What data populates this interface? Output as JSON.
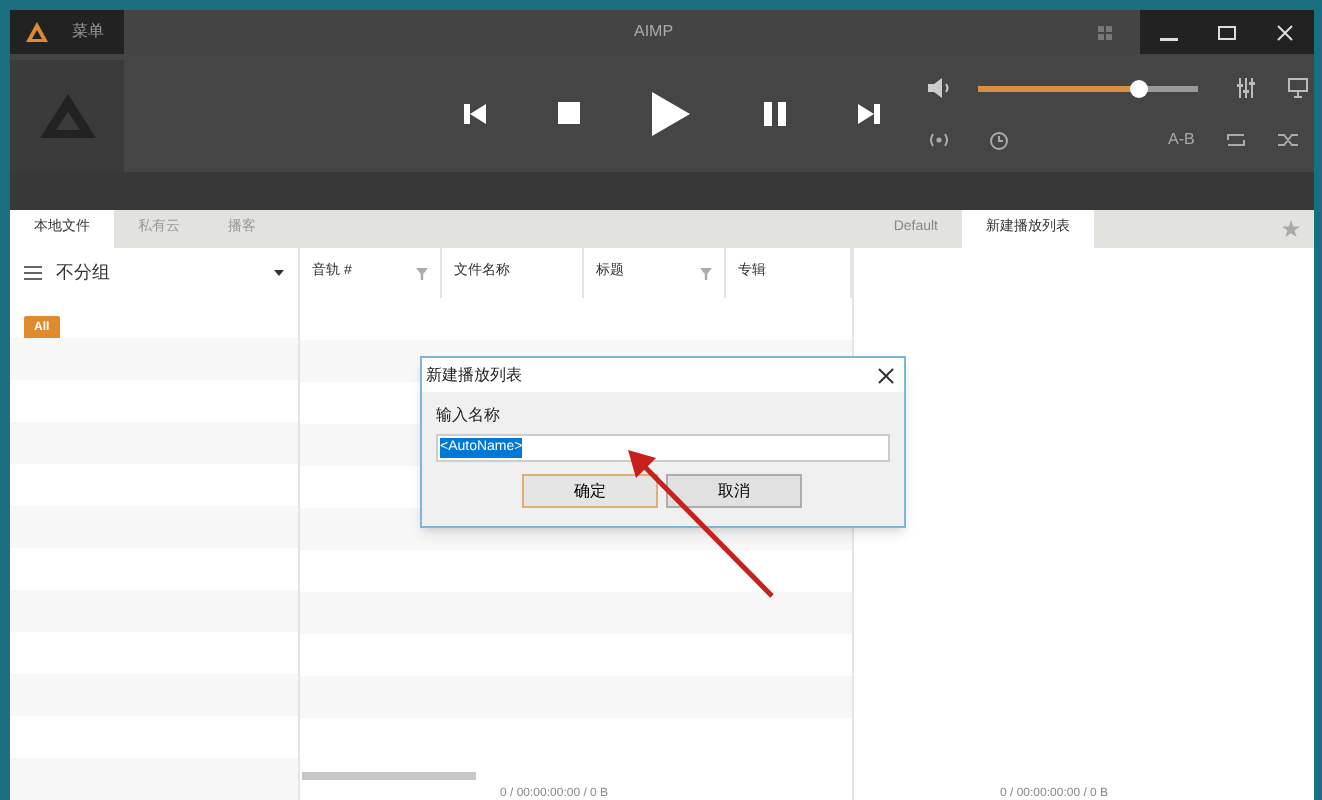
{
  "window": {
    "title": "AIMP",
    "menu": "菜单"
  },
  "player": {
    "volume": {
      "level": 0.73
    },
    "ab_label": "A-B"
  },
  "tabs": [
    {
      "label": "本地文件",
      "selected": true
    },
    {
      "label": "私有云",
      "selected": false
    },
    {
      "label": "播客",
      "selected": false
    }
  ],
  "playlist_tabs": [
    {
      "label": "Default",
      "selected": false
    },
    {
      "label": "新建播放列表",
      "selected": true
    }
  ],
  "sidebar": {
    "grouping": "不分组",
    "filter_badge": "All"
  },
  "table": {
    "columns": [
      "音轨 #",
      "文件名称",
      "标题",
      "专辑"
    ]
  },
  "status": {
    "left": "0 / 00:00:00:00 / 0 B",
    "right": "0 / 00:00:00:00 / 0 B"
  },
  "dialog": {
    "title": "新建播放列表",
    "label": "输入名称",
    "value": "<AutoName>",
    "buttons": [
      "确定",
      "取消"
    ]
  }
}
